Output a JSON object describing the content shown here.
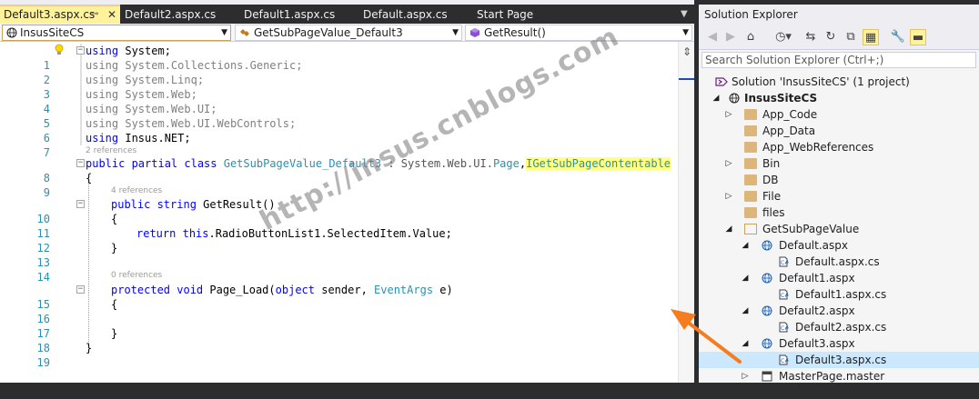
{
  "editor": {
    "tabs": [
      {
        "label": "Default3.aspx.cs",
        "active": true
      },
      {
        "label": "Default2.aspx.cs"
      },
      {
        "label": "Default1.aspx.cs"
      },
      {
        "label": "Default.aspx.cs"
      },
      {
        "label": "Start Page"
      }
    ],
    "tab_pin": "⊸",
    "tab_close": "✕",
    "tab_overflow": "▼",
    "nav": {
      "project": "InsusSiteCS",
      "class": "GetSubPageValue_Default3",
      "member": "GetResult()"
    },
    "lens": {
      "class_refs": "2 references",
      "getresult_refs": "4 references",
      "pageload_refs": "0 references"
    },
    "lines": {
      "l1": {
        "num": "1",
        "kw": "using",
        "rest": " System;"
      },
      "l2": {
        "num": "2",
        "text": "using System.Collections.Generic;"
      },
      "l3": {
        "num": "3",
        "text": "using System.Linq;"
      },
      "l4": {
        "num": "4",
        "text": "using System.Web;"
      },
      "l5": {
        "num": "5",
        "text": "using System.Web.UI;"
      },
      "l6": {
        "num": "6",
        "text": "using System.Web.UI.WebControls;"
      },
      "l7": {
        "num": "7",
        "kw": "using",
        "rest": " Insus.NET;"
      },
      "l8": {
        "num": "8",
        "kw": "public partial class",
        "cls": "GetSubPageValue_Default3",
        "mid": " : System.Web.UI.",
        "base": "Page",
        "comma": ",",
        "iface": "IGetSubPageContentable"
      },
      "l9": {
        "num": "9",
        "text": "{"
      },
      "l10": {
        "num": "10",
        "kw": "public string",
        "rest": " GetResult()"
      },
      "l11": {
        "num": "11",
        "text": "{"
      },
      "l12": {
        "num": "12",
        "kw": "return",
        "kw2": "this",
        "rest": ".RadioButtonList1.SelectedItem.Value;"
      },
      "l13": {
        "num": "13",
        "text": "}"
      },
      "l14": {
        "num": "14"
      },
      "l15": {
        "num": "15",
        "kw": "protected void",
        "rest": " Page_Load(",
        "kw2": "object",
        "rest2": " sender, ",
        "ty": "EventArgs",
        "rest3": " e)"
      },
      "l16": {
        "num": "16",
        "text": "{"
      },
      "l17": {
        "num": "17"
      },
      "l18": {
        "num": "18",
        "text": "}"
      },
      "l19": {
        "num": "19",
        "text": "}"
      }
    },
    "watermark": "http://insus.cnblogs.com"
  },
  "solution_explorer": {
    "title": "Solution Explorer",
    "search_placeholder": "Search Solution Explorer (Ctrl+;)",
    "solution": "Solution 'InsusSiteCS' (1 project)",
    "project": "InsusSiteCS",
    "items": {
      "app_code": "App_Code",
      "app_data": "App_Data",
      "app_webrefs": "App_WebReferences",
      "bin": "Bin",
      "db": "DB",
      "file": "File",
      "files": "files",
      "getsubpagevalue": "GetSubPageValue",
      "default_aspx": "Default.aspx",
      "default_cs": "Default.aspx.cs",
      "default1_aspx": "Default1.aspx",
      "default1_cs": "Default1.aspx.cs",
      "default2_aspx": "Default2.aspx",
      "default2_cs": "Default2.aspx.cs",
      "default3_aspx": "Default3.aspx",
      "default3_cs": "Default3.aspx.cs",
      "masterpage": "MasterPage.master"
    }
  },
  "colors": {
    "active_tab": "#fff29d",
    "keyword": "#0000ff",
    "type": "#2b91af",
    "arrow": "#f57c1f",
    "selected_row": "#cce8ff"
  }
}
